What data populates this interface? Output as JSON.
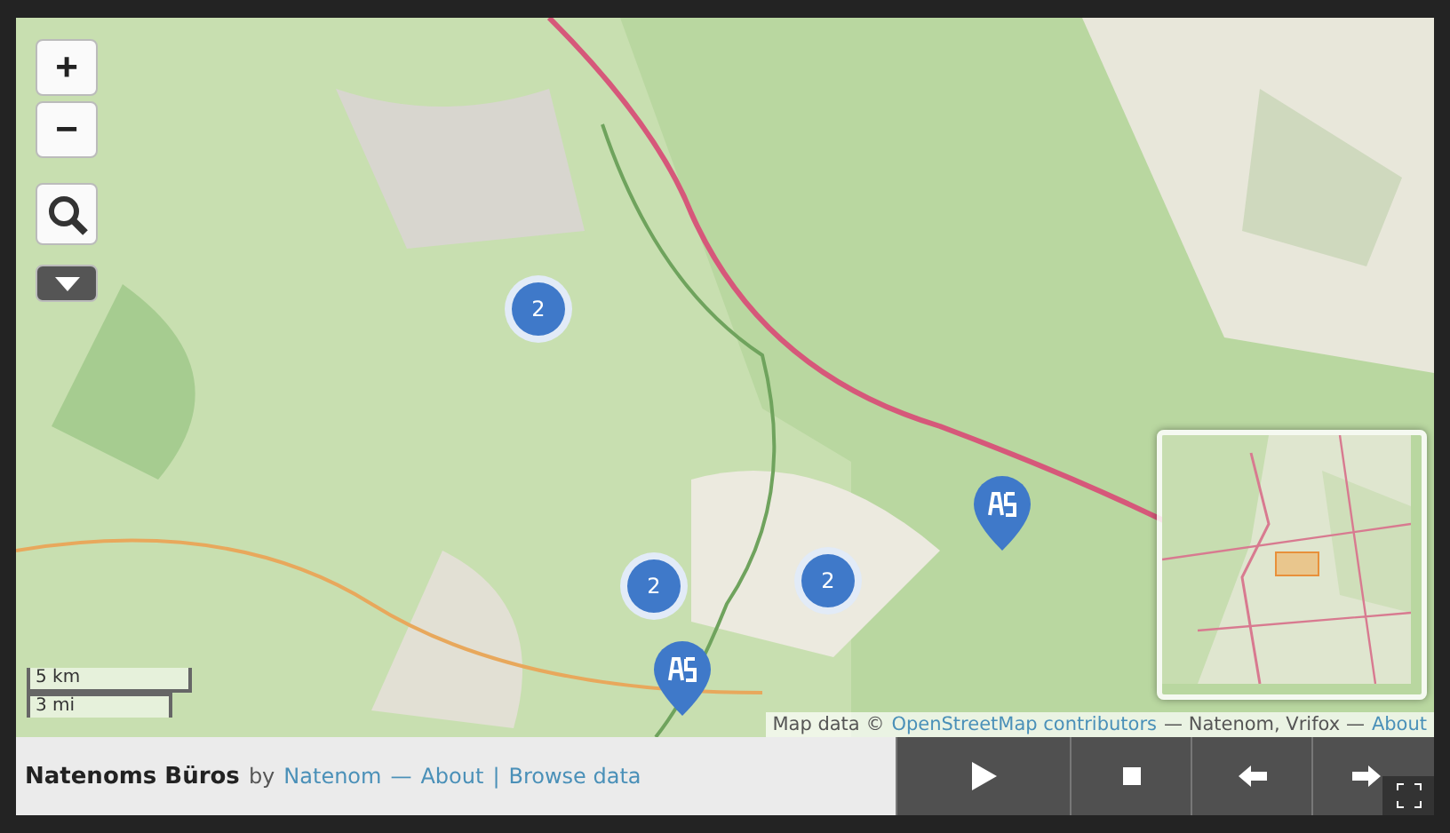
{
  "map_controls": {
    "zoom_in": "+",
    "zoom_out": "−",
    "layers_expanded": false
  },
  "clusters": [
    {
      "count": "2"
    },
    {
      "count": "2"
    },
    {
      "count": "2"
    }
  ],
  "scale": {
    "metric": "5 km",
    "imperial": "3 mi"
  },
  "attribution": {
    "prefix": "Map data ©",
    "link": "OpenStreetMap contributors",
    "credits": "— Natenom, Vrifox —",
    "about": "About"
  },
  "footer": {
    "title": "Natenoms Büros",
    "by": "by",
    "author": "Natenom",
    "dash": "—",
    "about": "About",
    "divider": "|",
    "browse": "Browse data"
  },
  "playback": [
    {
      "kind": "play"
    },
    {
      "kind": "stop"
    },
    {
      "kind": "back"
    },
    {
      "kind": "forward"
    }
  ]
}
